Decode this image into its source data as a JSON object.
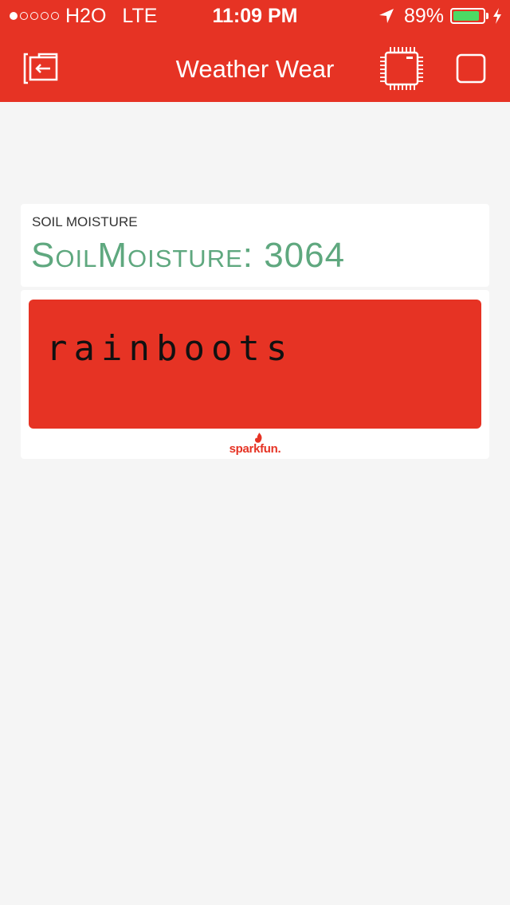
{
  "status_bar": {
    "signal_bars_filled": 1,
    "signal_bars_total": 5,
    "carrier": "H2O",
    "network": "LTE",
    "time": "11:09 PM",
    "battery_percent_label": "89%",
    "battery_level": 0.89,
    "icons": [
      "location-arrow-icon",
      "battery-icon",
      "charging-bolt-icon"
    ]
  },
  "nav": {
    "title": "Weather Wear",
    "icons": [
      "exit-icon",
      "chip-icon",
      "square-icon"
    ]
  },
  "widgets": {
    "soil": {
      "label": "SOIL MOISTURE",
      "value": "SoilMoisture: 3064"
    },
    "lcd": {
      "text": "rainboots"
    },
    "brand": {
      "name": "sparkfun."
    }
  },
  "colors": {
    "accent": "#e63324",
    "value_green": "#5fa87f",
    "battery_green": "#4cd964",
    "background": "#f5f5f5"
  }
}
